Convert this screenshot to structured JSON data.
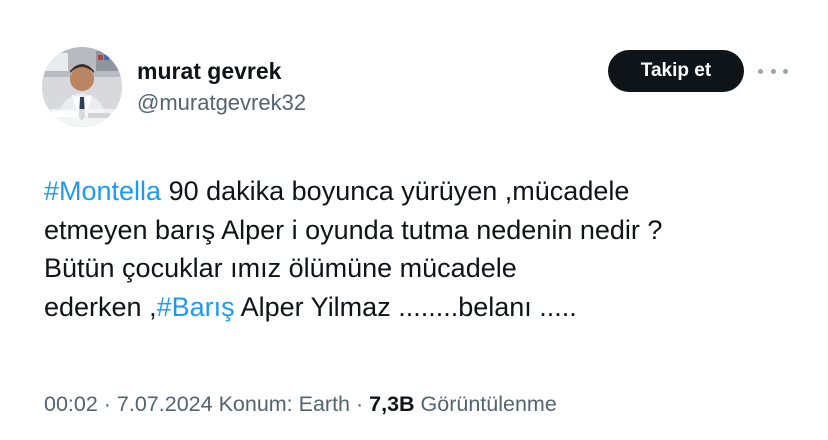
{
  "user": {
    "display_name": "murat gevrek",
    "handle": "@muratgevrek32"
  },
  "actions": {
    "follow_label": "Takip et",
    "more_icon": "more-horizontal-icon"
  },
  "tweet": {
    "lines": [
      {
        "hashtag": "#Montella",
        "text": " 90 dakika boyunca yürüyen ,mücadele"
      },
      {
        "text": "etmeyen barış Alper i oyunda tutma nedenin nedir ?"
      },
      {
        "text": "Bütün çocuklar ımız ölümüne mücadele"
      },
      {
        "prefix": "ederken ,",
        "hashtag": "#Barış",
        "suffix": " Alper Yilmaz ........belanı ....."
      }
    ]
  },
  "meta": {
    "time": "00:02",
    "separator": " · ",
    "date": "7.07.2024",
    "location": "Konum: Earth",
    "views_count": "7,3B",
    "views_label": " Görüntülenme"
  },
  "colors": {
    "text": "#0f1419",
    "secondary": "#536471",
    "link": "#1d9bf0",
    "button_bg": "#0f1419",
    "button_text": "#ffffff"
  }
}
